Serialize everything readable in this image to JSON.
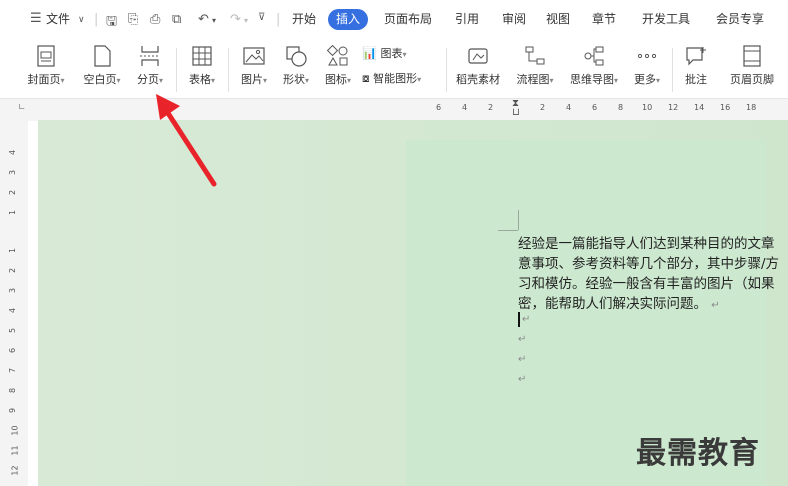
{
  "menubar": {
    "file_label": "文件",
    "tabs": [
      {
        "label": "开始"
      },
      {
        "label": "插入",
        "active": true
      },
      {
        "label": "页面布局"
      },
      {
        "label": "引用"
      },
      {
        "label": "审阅"
      },
      {
        "label": "视图"
      },
      {
        "label": "章节"
      },
      {
        "label": "开发工具"
      },
      {
        "label": "会员专享"
      }
    ]
  },
  "ribbon": {
    "cover_page": "封面页",
    "blank_page": "空白页",
    "page_break": "分页",
    "table": "表格",
    "picture": "图片",
    "shape": "形状",
    "icon": "图标",
    "chart": "图表",
    "smart_art": "智能图形",
    "template_material": "稻壳素材",
    "flowchart": "流程图",
    "mind_map": "思维导图",
    "more": "更多",
    "comment": "批注",
    "header_footer": "页眉页脚"
  },
  "rulers": {
    "horizontal": [
      "6",
      "4",
      "2",
      "2",
      "4",
      "6",
      "8",
      "10",
      "12",
      "14",
      "16",
      "18"
    ],
    "vertical": [
      "4",
      "3",
      "2",
      "1",
      "1",
      "2",
      "3",
      "4",
      "5",
      "6",
      "7",
      "8",
      "9",
      "10",
      "11",
      "12"
    ]
  },
  "document": {
    "lines": [
      "经验是一篇能指导人们达到某种目的的文章",
      "意事项、参考资料等几个部分，其中步骤/方",
      "习和模仿。经验一般含有丰富的图片（如果",
      "密，能帮助人们解决实际问题。"
    ],
    "paragraph_mark": "↵"
  },
  "watermark": "最需教育",
  "colors": {
    "accent": "#3670e0",
    "canvas": "#cfe6cd",
    "page": "#cce8cf",
    "arrow": "#e8242a"
  }
}
